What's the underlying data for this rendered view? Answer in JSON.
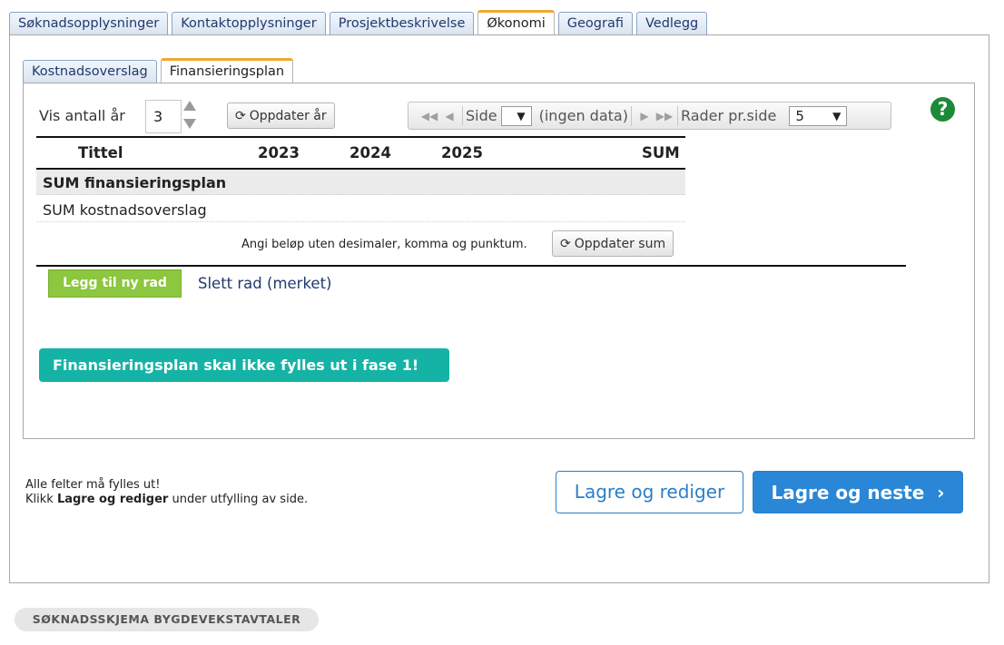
{
  "top_tabs": [
    {
      "label": "Søknadsopplysninger",
      "active": false
    },
    {
      "label": "Kontaktopplysninger",
      "active": false
    },
    {
      "label": "Prosjektbeskrivelse",
      "active": false
    },
    {
      "label": "Økonomi",
      "active": true
    },
    {
      "label": "Geografi",
      "active": false
    },
    {
      "label": "Vedlegg",
      "active": false
    }
  ],
  "sub_tabs": [
    {
      "label": "Kostnadsoverslag",
      "active": false
    },
    {
      "label": "Finansieringsplan",
      "active": true
    }
  ],
  "controls": {
    "vis_label": "Vis antall år",
    "years_value": "3",
    "update_years_label": "Oppdater år"
  },
  "pager": {
    "page_label": "Side",
    "status": "(ingen data)",
    "rows_label": "Rader pr.side",
    "rows_value": "5"
  },
  "table": {
    "headers": [
      "Tittel",
      "2023",
      "2024",
      "2025",
      "SUM"
    ],
    "rows": [
      "SUM finansieringsplan",
      "SUM kostnadsoverslag"
    ]
  },
  "hint": "Angi beløp uten desimaler, komma og punktum.",
  "update_sum_label": "Oppdater sum",
  "add_row_label": "Legg til ny rad",
  "delete_row_label": "Slett rad (merket)",
  "notice": "Finansieringsplan skal ikke fylles ut i fase 1!",
  "footer_note": {
    "line1": "Alle felter må fylles ut!",
    "line2_prefix": "Klikk ",
    "line2_bold": "Lagre og rediger",
    "line2_suffix": " under utfylling av side."
  },
  "save_edit_label": "Lagre og rediger",
  "save_next_label": "Lagre og neste",
  "form_name": "SØKNADSSKJEMA BYGDEVEKSTAVTALER",
  "colors": {
    "tab_active_accent": "#f0a830",
    "primary": "#2a86d6",
    "add_button": "#8dc63f",
    "notice": "#14b3a5",
    "help": "#1d8a3a"
  }
}
